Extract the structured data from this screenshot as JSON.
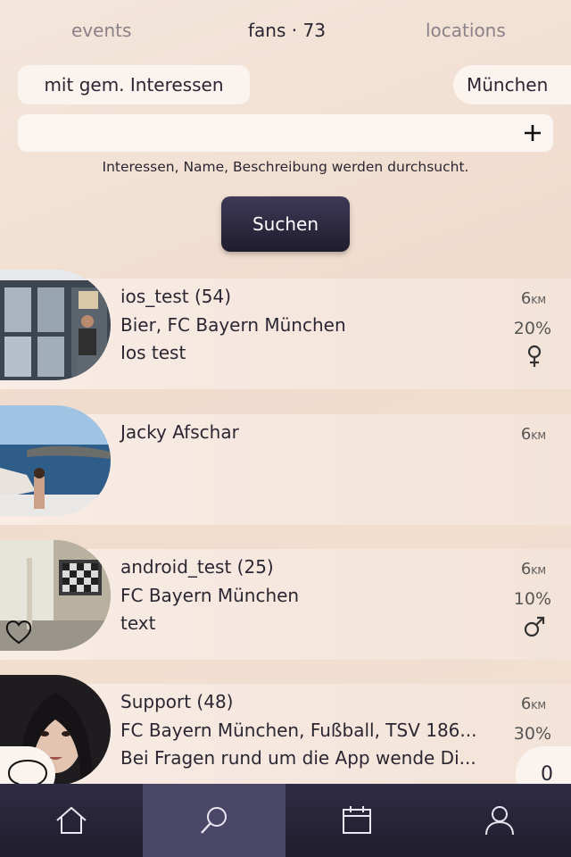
{
  "tabs": [
    {
      "label": "events"
    },
    {
      "label": "fans · 73"
    },
    {
      "label": "locations"
    }
  ],
  "filters": {
    "interests": "mit gem. Interessen",
    "location": "München"
  },
  "search": {
    "value": "",
    "placeholder": "",
    "hint": "Interessen, Name, Beschreibung werden durchsucht.",
    "button": "Suchen"
  },
  "fans": [
    {
      "name": "ios_test (54)",
      "line2": "Bier, FC Bayern München",
      "line3": "Ios test",
      "distance": "6",
      "distance_unit": "KM",
      "match": "20%",
      "gender": "female"
    },
    {
      "name": "Jacky Afschar",
      "line2": "",
      "line3": "",
      "distance": "6",
      "distance_unit": "KM",
      "match": "",
      "gender": ""
    },
    {
      "name": "android_test (25)",
      "line2": "FC Bayern München",
      "line3": "text",
      "distance": "6",
      "distance_unit": "KM",
      "match": "10%",
      "gender": "male"
    },
    {
      "name": "Support (48)",
      "line2": "FC Bayern München, Fußball, TSV 186...",
      "line3": "Bei Fragen rund um die App wende Di...",
      "distance": "6",
      "distance_unit": "KM",
      "match": "30%",
      "gender": ""
    }
  ],
  "counter": "0",
  "nav": [
    {
      "icon": "home-icon"
    },
    {
      "icon": "search-icon"
    },
    {
      "icon": "calendar-icon"
    },
    {
      "icon": "profile-icon"
    }
  ]
}
